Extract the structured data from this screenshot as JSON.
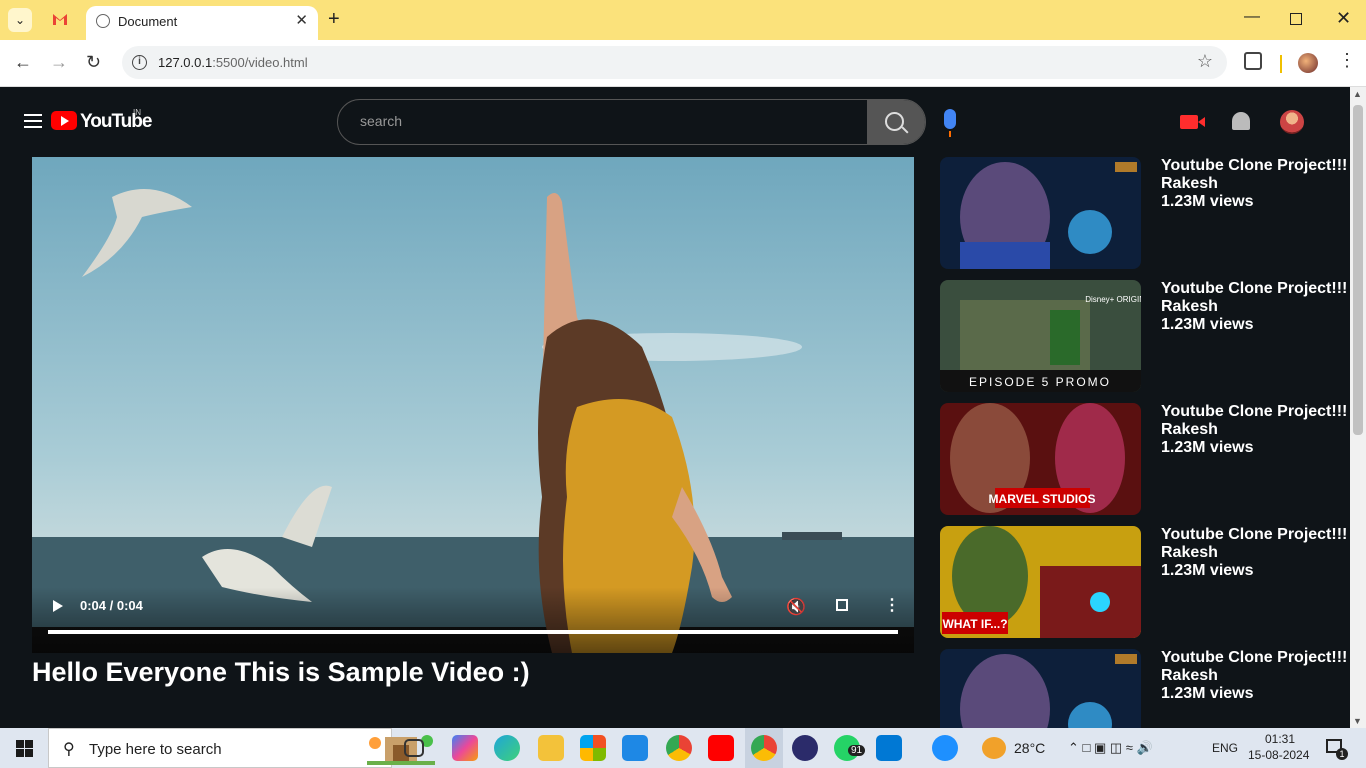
{
  "browser": {
    "tab_title": "Document",
    "url_host": "127.0.0.1",
    "url_rest": ":5500/video.html"
  },
  "header": {
    "logo_text": "YouTube",
    "region": "IN",
    "search_placeholder": "search"
  },
  "player": {
    "time": "0:04 / 0:04",
    "progress": 1.0
  },
  "video_title": "Hello Everyone This is Sample Video :)",
  "recommendations": [
    {
      "title": "Youtube Clone Project!!!",
      "channel": "Rakesh",
      "views": "1.23M views",
      "thumb": "thanos"
    },
    {
      "title": "Youtube Clone Project!!!",
      "channel": "Rakesh",
      "views": "1.23M views",
      "thumb": "loki",
      "thumb_text": "EPISODE 5 PROMO",
      "thumb_badge": "Disney+ ORIGINAL"
    },
    {
      "title": "Youtube Clone Project!!!",
      "channel": "Rakesh",
      "views": "1.23M views",
      "thumb": "marvel",
      "thumb_text": "MARVEL STUDIOS"
    },
    {
      "title": "Youtube Clone Project!!!",
      "channel": "Rakesh",
      "views": "1.23M views",
      "thumb": "whatif",
      "thumb_text": "WHAT IF...?"
    },
    {
      "title": "Youtube Clone Project!!!",
      "channel": "Rakesh",
      "views": "1.23M views",
      "thumb": "thanos"
    }
  ],
  "taskbar": {
    "search_text": "Type here to search",
    "whatsapp_badge": "91",
    "temperature": "28°C",
    "language": "ENG",
    "time": "01:31",
    "date": "15-08-2024",
    "notifications": "1"
  }
}
